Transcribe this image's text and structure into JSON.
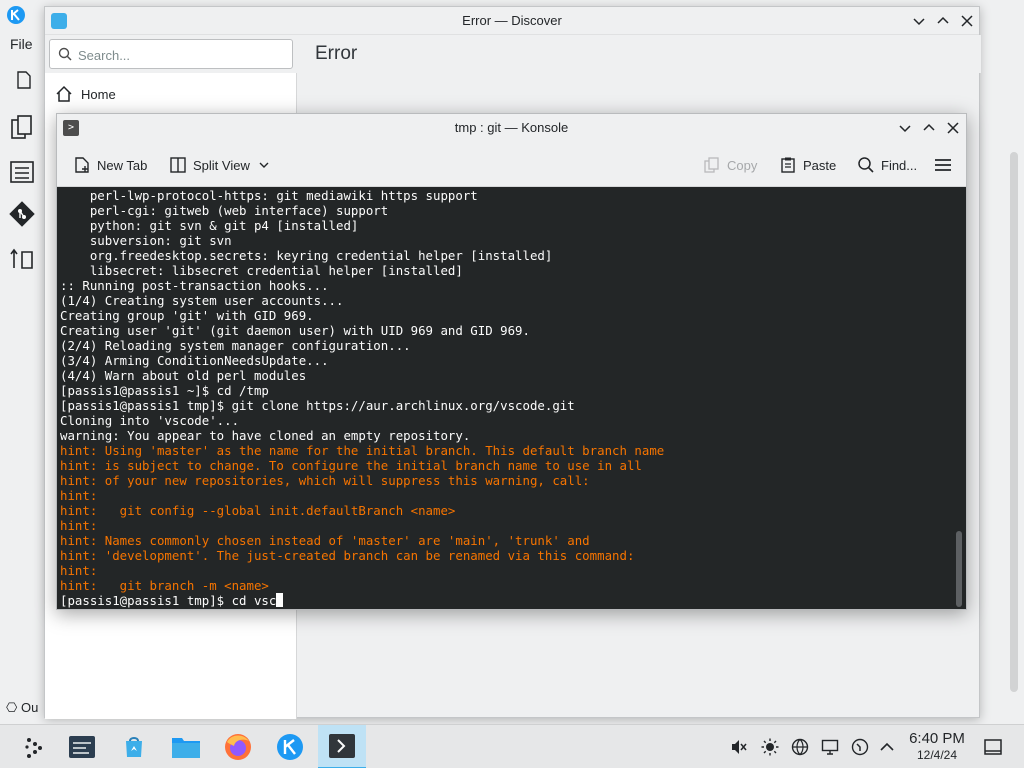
{
  "background_app": {
    "file_menu": "File",
    "bottom_text": "Ou"
  },
  "discover": {
    "title": "Error — Discover",
    "search_placeholder": "Search...",
    "page_title": "Error",
    "nav_home": "Home"
  },
  "konsole": {
    "title": "tmp : git — Konsole",
    "toolbar": {
      "new_tab": "New Tab",
      "split_view": "Split View",
      "copy": "Copy",
      "paste": "Paste",
      "find": "Find..."
    },
    "terminal_lines": [
      {
        "text": "    perl-lwp-protocol-https: git mediawiki https support",
        "hint": false
      },
      {
        "text": "    perl-cgi: gitweb (web interface) support",
        "hint": false
      },
      {
        "text": "    python: git svn & git p4 [installed]",
        "hint": false
      },
      {
        "text": "    subversion: git svn",
        "hint": false
      },
      {
        "text": "    org.freedesktop.secrets: keyring credential helper [installed]",
        "hint": false
      },
      {
        "text": "    libsecret: libsecret credential helper [installed]",
        "hint": false
      },
      {
        "text": ":: Running post-transaction hooks...",
        "hint": false
      },
      {
        "text": "(1/4) Creating system user accounts...",
        "hint": false
      },
      {
        "text": "Creating group 'git' with GID 969.",
        "hint": false
      },
      {
        "text": "Creating user 'git' (git daemon user) with UID 969 and GID 969.",
        "hint": false
      },
      {
        "text": "(2/4) Reloading system manager configuration...",
        "hint": false
      },
      {
        "text": "(3/4) Arming ConditionNeedsUpdate...",
        "hint": false
      },
      {
        "text": "(4/4) Warn about old perl modules",
        "hint": false
      },
      {
        "text": "[passis1@passis1 ~]$ cd /tmp",
        "hint": false
      },
      {
        "text": "[passis1@passis1 tmp]$ git clone https://aur.archlinux.org/vscode.git",
        "hint": false
      },
      {
        "text": "Cloning into 'vscode'...",
        "hint": false
      },
      {
        "text": "warning: You appear to have cloned an empty repository.",
        "hint": false
      },
      {
        "text": "hint: Using 'master' as the name for the initial branch. This default branch name",
        "hint": true
      },
      {
        "text": "hint: is subject to change. To configure the initial branch name to use in all",
        "hint": true
      },
      {
        "text": "hint: of your new repositories, which will suppress this warning, call:",
        "hint": true
      },
      {
        "text": "hint:",
        "hint": true
      },
      {
        "text": "hint:   git config --global init.defaultBranch <name>",
        "hint": true
      },
      {
        "text": "hint:",
        "hint": true
      },
      {
        "text": "hint: Names commonly chosen instead of 'master' are 'main', 'trunk' and",
        "hint": true
      },
      {
        "text": "hint: 'development'. The just-created branch can be renamed via this command:",
        "hint": true
      },
      {
        "text": "hint:",
        "hint": true
      },
      {
        "text": "hint:   git branch -m <name>",
        "hint": true
      }
    ],
    "prompt_line": "[passis1@passis1 tmp]$ cd vsc",
    "hint_color": "#f67400",
    "terminal_bg": "#232627"
  },
  "taskbar": {
    "apps": [
      "application-launcher-icon",
      "system-monitor-icon",
      "discover-icon",
      "file-manager-icon",
      "firefox-icon",
      "kde-icon",
      "konsole-icon"
    ],
    "active_app": "konsole-icon",
    "time": "6:40 PM",
    "date": "12/4/24"
  },
  "colors": {
    "accent": "#3daee9",
    "window_bg": "#eff0f1"
  }
}
